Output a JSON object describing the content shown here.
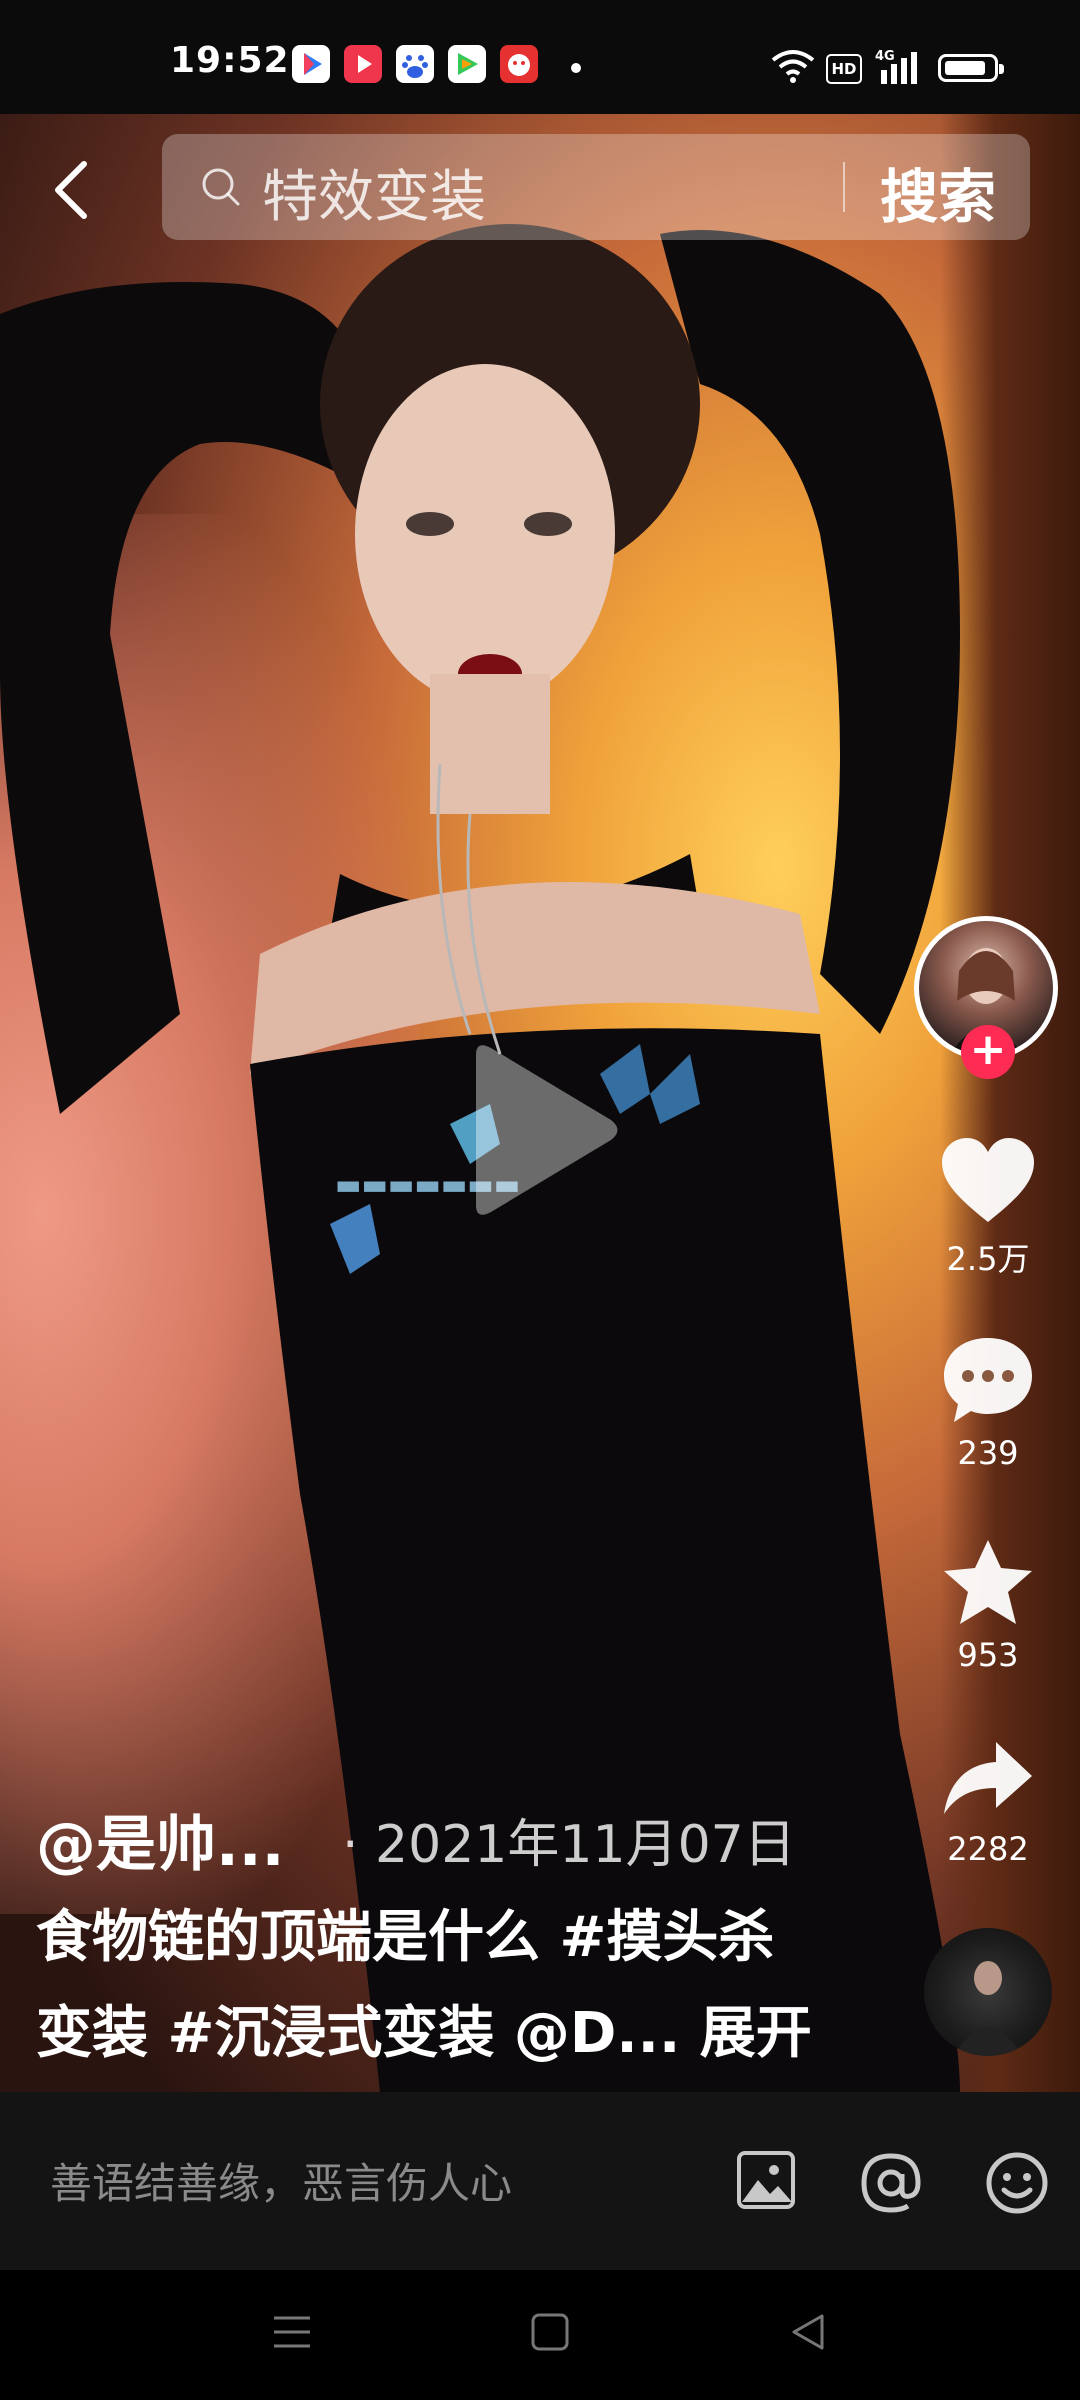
{
  "status_bar": {
    "time": "19:52",
    "notification_icons": [
      "video-app-icon",
      "video-player-icon",
      "baidu-icon",
      "game-app-icon",
      "red-app-icon"
    ],
    "network": "4G",
    "hd_label": "HD"
  },
  "search": {
    "query": "特效变装",
    "button_label": "搜索"
  },
  "rail": {
    "likes": "2.5万",
    "comments": "239",
    "favorites": "953",
    "shares": "2282"
  },
  "post": {
    "author": "@是帅...",
    "date": "· 2021年11月07日",
    "caption_line1": "食物链的顶端是什么 #摸头杀",
    "caption_line2_prefix": "变装 #沉浸式变装 @D...",
    "expand_label": "展开"
  },
  "comment_bar": {
    "placeholder": "善语结善缘，恶言伤人心"
  },
  "colors": {
    "accent": "#fe2c55",
    "bar_bg": "#141414"
  }
}
